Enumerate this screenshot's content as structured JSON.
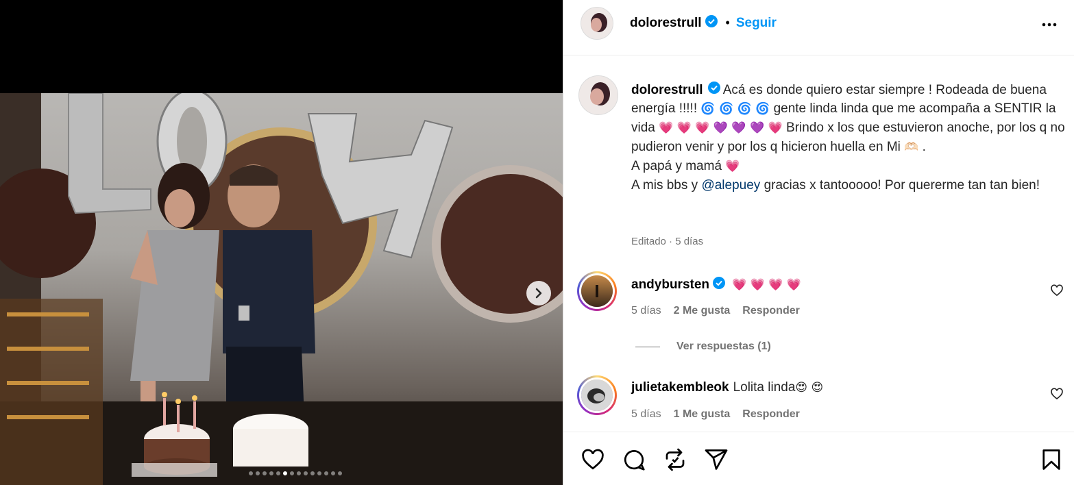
{
  "post": {
    "username": "dolorestrull",
    "follow_label": "Seguir",
    "separator": "•",
    "caption_lines": [
      "Acá es donde quiero estar siempre ! Rodeada de",
      "buena energía !!!!!",
      "gente linda linda que me acompaña",
      "a SENTIR la vida",
      "Brindo x los que estuvieron",
      "anoche, por los q no pudieron venir y por los q hicieron huella en",
      "Mi",
      ".",
      "A papá y mamá",
      "A mis bbs y",
      "@alepuey",
      "gracias x tantooooo! Por quererme tan tan",
      "bien!"
    ],
    "caption_emojis": {
      "swirls": "🌀 🌀 🌀 🌀",
      "hearts": "💗 💗 💗 💜 💜 💜 💗",
      "heart_hands": "🫶🏻",
      "pink_heart": "💗"
    },
    "edited_label": "Editado · 5 días"
  },
  "comments": [
    {
      "username": "andybursten",
      "verified": true,
      "text": "💗 💗 💗 💗",
      "time": "5 días",
      "likes": "2 Me gusta",
      "reply_label": "Responder",
      "view_replies": "Ver respuestas (1)"
    },
    {
      "username": "julietakembleok",
      "verified": false,
      "text": "Lolita linda",
      "emoji": "😍 😍",
      "time": "5 días",
      "likes": "1 Me gusta",
      "reply_label": "Responder"
    }
  ],
  "media": {
    "dots_total": 14,
    "dot_active_index": 5
  },
  "icons": {
    "verified": "verified-badge-icon",
    "more": "more-options-icon",
    "like": "heart-icon",
    "comment": "comment-icon",
    "repost": "repost-icon",
    "share": "share-icon",
    "save": "bookmark-icon",
    "next": "chevron-right-icon"
  },
  "colors": {
    "link_blue": "#0095f6",
    "mention": "#00376b",
    "muted": "#737373",
    "verified_blue": "#0095f6"
  }
}
